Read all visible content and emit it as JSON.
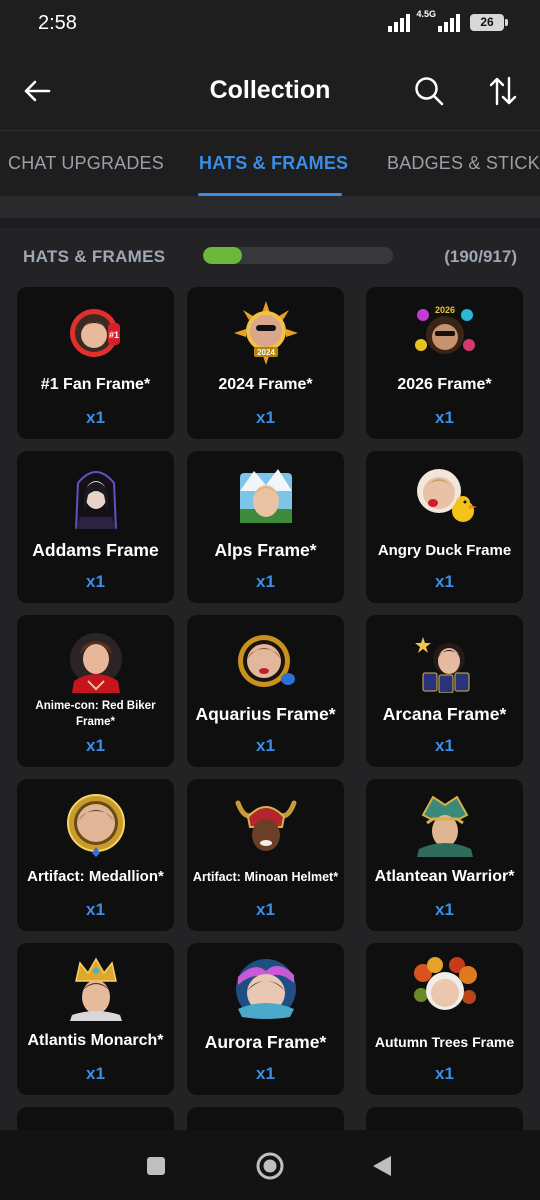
{
  "status_bar": {
    "time": "2:58",
    "network": "4.5G",
    "battery": "26"
  },
  "header": {
    "title": "Collection"
  },
  "tabs": [
    {
      "label": "CHAT UPGRADES",
      "active": false
    },
    {
      "label": "HATS & FRAMES",
      "active": true
    },
    {
      "label": "BADGES & STICKERS",
      "active": false
    }
  ],
  "section": {
    "title": "HATS & FRAMES",
    "count": "(190/917)",
    "progress": 0.207
  },
  "items": [
    {
      "name": "#1 Fan Frame*",
      "qty": "x1",
      "icon": "fan-frame-avatar"
    },
    {
      "name": "2024 Frame*",
      "qty": "x1",
      "icon": "2024-frame-avatar"
    },
    {
      "name": "2026 Frame*",
      "qty": "x1",
      "icon": "2026-frame-avatar"
    },
    {
      "name": "Addams Frame",
      "qty": "x1",
      "icon": "addams-frame-avatar"
    },
    {
      "name": "Alps Frame*",
      "qty": "x1",
      "icon": "alps-frame-avatar"
    },
    {
      "name": "Angry Duck Frame",
      "qty": "x1",
      "icon": "angry-duck-frame-avatar"
    },
    {
      "name": "Anime-con: Red Biker Frame*",
      "qty": "x1",
      "icon": "anime-con-frame-avatar"
    },
    {
      "name": "Aquarius Frame*",
      "qty": "x1",
      "icon": "aquarius-frame-avatar"
    },
    {
      "name": "Arcana Frame*",
      "qty": "x1",
      "icon": "arcana-frame-avatar"
    },
    {
      "name": "Artifact: Medallion*",
      "qty": "x1",
      "icon": "medallion-frame-avatar"
    },
    {
      "name": "Artifact: Minoan Helmet*",
      "qty": "x1",
      "icon": "minoan-helmet-avatar"
    },
    {
      "name": "Atlantean Warrior*",
      "qty": "x1",
      "icon": "atlantean-warrior-avatar"
    },
    {
      "name": "Atlantis Monarch*",
      "qty": "x1",
      "icon": "atlantis-monarch-avatar"
    },
    {
      "name": "Aurora Frame*",
      "qty": "x1",
      "icon": "aurora-frame-avatar"
    },
    {
      "name": "Autumn Trees Frame",
      "qty": "x1",
      "icon": "autumn-trees-frame-avatar"
    }
  ],
  "colors": {
    "accent": "#3a8ee6",
    "progress": "#6ab83c",
    "card": "#0f0f10",
    "background": "#1c1c1e"
  }
}
